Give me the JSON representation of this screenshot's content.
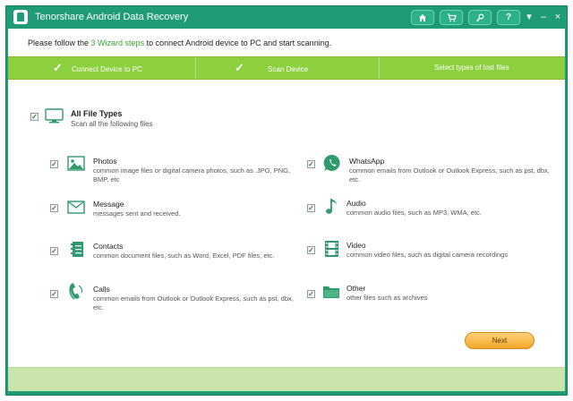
{
  "window": {
    "title": "Tenorshare Android Data Recovery",
    "buttons": {
      "home": "home-icon",
      "cart": "cart-icon",
      "key": "key-icon",
      "help": "?",
      "menu": "▾",
      "minimize": "–",
      "close": "×"
    }
  },
  "instruction": {
    "before": "Please follow the ",
    "highlight": "3 Wizard steps",
    "after": " to connect Android device to PC and start scanning."
  },
  "steps": [
    {
      "label": "Connect Device to PC",
      "done": true
    },
    {
      "label": "Scan Device",
      "done": true
    },
    {
      "label": "Select types of lost files",
      "done": false
    }
  ],
  "all_types": {
    "title": "All File Types",
    "desc": "Scan all the following files",
    "checked": true
  },
  "file_types": {
    "photos": {
      "title": "Photos",
      "desc": "common image files or digital camera photos, such as .JPG, PNG, BMP, etc",
      "icon": "image-icon"
    },
    "message": {
      "title": "Message",
      "desc": "messages sent and received.",
      "icon": "envelope-icon"
    },
    "contacts": {
      "title": "Contacts",
      "desc": "common document files, such as Word, Excel, PDF files, etc.",
      "icon": "contacts-book-icon"
    },
    "calls": {
      "title": "Calls",
      "desc": "common emails from Outlook or Outlook Express, such as pst, dbx, etc.",
      "icon": "phone-icon"
    },
    "whatsapp": {
      "title": "WhatsApp",
      "desc": "common emails from Outlook or Outlook Express, such as pst, dbx, etc.",
      "icon": "whatsapp-icon"
    },
    "audio": {
      "title": "Audio",
      "desc": "common audio files, such as MP3, WMA, etc.",
      "icon": "music-note-icon"
    },
    "video": {
      "title": "Video",
      "desc": "common video files, such as digital camera recordings",
      "icon": "film-icon"
    },
    "other": {
      "title": "Other",
      "desc": "other files such as archives",
      "icon": "folder-icon"
    }
  },
  "next_label": "Next",
  "colors": {
    "brand_green": "#1f9c77",
    "step_bar": "#8ccf3f",
    "footer": "#c9e5ac",
    "next_button": "#f3a628",
    "highlight_text": "#3aa534"
  }
}
